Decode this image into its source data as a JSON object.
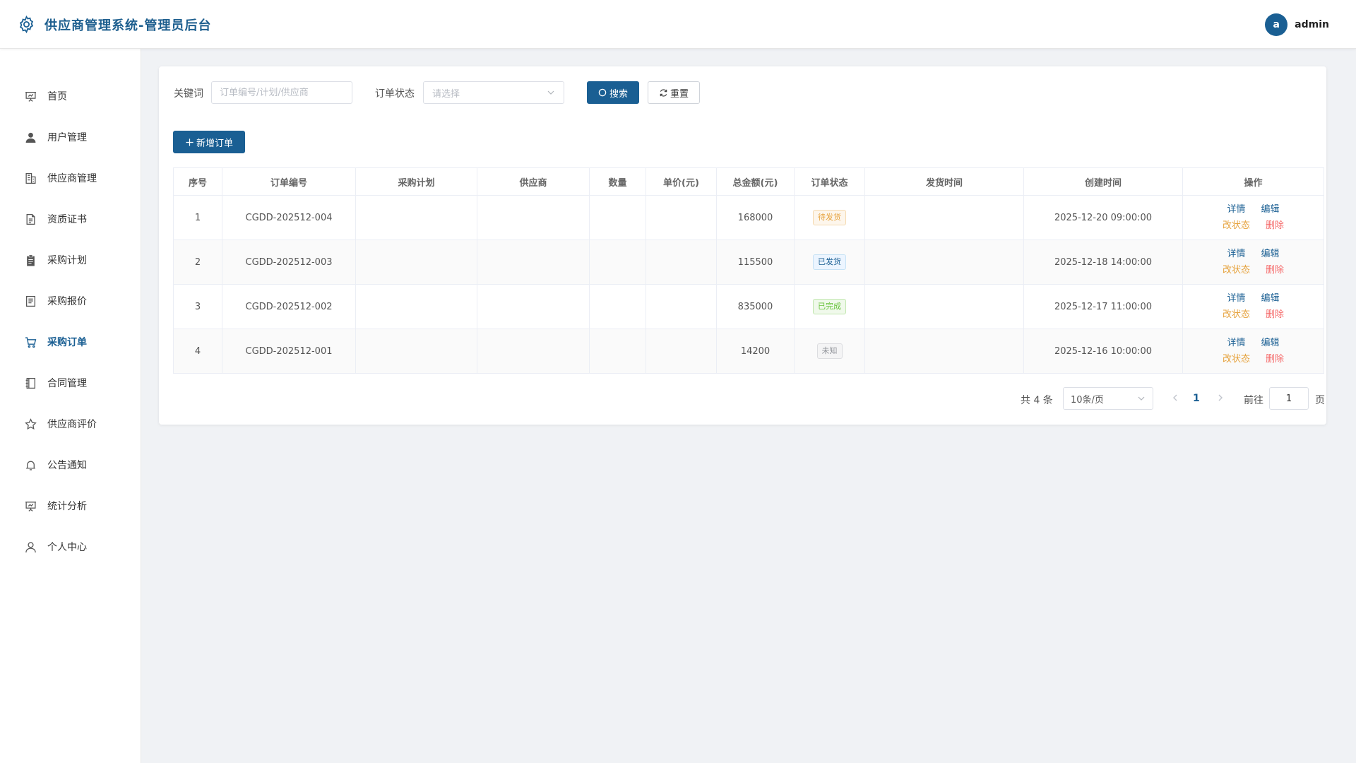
{
  "header": {
    "title": "供应商管理系统-管理员后台",
    "avatar_letter": "a",
    "username": "admin"
  },
  "sidebar": {
    "items": [
      {
        "label": "首页",
        "icon": "presentation-icon"
      },
      {
        "label": "用户管理",
        "icon": "user-icon"
      },
      {
        "label": "供应商管理",
        "icon": "building-icon"
      },
      {
        "label": "资质证书",
        "icon": "document-icon"
      },
      {
        "label": "采购计划",
        "icon": "clipboard-icon"
      },
      {
        "label": "采购报价",
        "icon": "tickets-icon"
      },
      {
        "label": "采购订单",
        "icon": "cart-icon",
        "active": true
      },
      {
        "label": "合同管理",
        "icon": "notebook-icon"
      },
      {
        "label": "供应商评价",
        "icon": "star-icon"
      },
      {
        "label": "公告通知",
        "icon": "bell-icon"
      },
      {
        "label": "统计分析",
        "icon": "chart-board-icon"
      },
      {
        "label": "个人中心",
        "icon": "user-outline-icon"
      }
    ]
  },
  "filters": {
    "keyword_label": "关键词",
    "keyword_placeholder": "订单编号/计划/供应商",
    "keyword_value": "",
    "status_label": "订单状态",
    "status_placeholder": "请选择",
    "search_label": "搜索",
    "reset_label": "重置"
  },
  "toolbar": {
    "add_label": "新增订单"
  },
  "table": {
    "columns": [
      "序号",
      "订单编号",
      "采购计划",
      "供应商",
      "数量",
      "单价(元)",
      "总金额(元)",
      "订单状态",
      "发货时间",
      "创建时间",
      "操作"
    ],
    "rows": [
      {
        "index": "1",
        "order_no": "CGDD-202512-004",
        "plan": "",
        "supplier": "",
        "quantity": "",
        "unit_price": "",
        "total": "168000",
        "status": "待发货",
        "status_type": "warning",
        "ship_time": "",
        "created": "2025-12-20 09:00:00"
      },
      {
        "index": "2",
        "order_no": "CGDD-202512-003",
        "plan": "",
        "supplier": "",
        "quantity": "",
        "unit_price": "",
        "total": "115500",
        "status": "已发货",
        "status_type": "info",
        "ship_time": "",
        "created": "2025-12-18 14:00:00"
      },
      {
        "index": "3",
        "order_no": "CGDD-202512-002",
        "plan": "",
        "supplier": "",
        "quantity": "",
        "unit_price": "",
        "total": "835000",
        "status": "已完成",
        "status_type": "success",
        "ship_time": "",
        "created": "2025-12-17 11:00:00"
      },
      {
        "index": "4",
        "order_no": "CGDD-202512-001",
        "plan": "",
        "supplier": "",
        "quantity": "",
        "unit_price": "",
        "total": "14200",
        "status": "未知",
        "status_type": "default",
        "ship_time": "",
        "created": "2025-12-16 10:00:00"
      }
    ],
    "actions": {
      "detail": "详情",
      "edit": "编辑",
      "change_status": "改状态",
      "delete": "删除"
    }
  },
  "pagination": {
    "total_text": "共 4 条",
    "page_size": "10条/页",
    "current_page": "1",
    "goto_label": "前往",
    "goto_value": "1",
    "page_suffix": "页"
  },
  "colors": {
    "primary": "#1a5f93",
    "warning": "#e6a23c",
    "danger": "#f56c6c",
    "success": "#67c23a"
  }
}
